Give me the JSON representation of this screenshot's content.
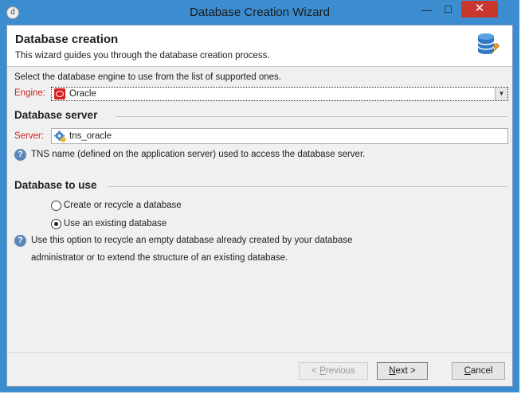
{
  "window": {
    "title": "Database Creation Wizard",
    "app_icon_glyph": "d",
    "controls": {
      "minimize": "—",
      "maximize": "☐",
      "close": "✕"
    }
  },
  "header": {
    "title": "Database creation",
    "subtitle": "This wizard guides you through the database creation process.",
    "icon": "database-wrench-icon"
  },
  "engine": {
    "intro": "Select the database engine to use from the list of supported ones.",
    "label": "Engine:",
    "selected": "Oracle",
    "selected_icon": "oracle-icon"
  },
  "database_server": {
    "heading": "Database server",
    "label": "Server:",
    "value": "tns_oracle",
    "field_icon": "server-gear-icon",
    "help": "TNS name (defined on the application server) used to access the database server."
  },
  "database_to_use": {
    "heading": "Database to use",
    "options": [
      {
        "label": "Create or recycle a database",
        "checked": false
      },
      {
        "label": "Use an existing database",
        "checked": true
      }
    ],
    "help_line1": "Use this option to recycle an empty database already created by your database",
    "help_line2": "administrator or to extend the structure of an existing database."
  },
  "footer": {
    "previous": {
      "prefix": "< ",
      "mnemonic": "P",
      "rest": "revious",
      "enabled": false
    },
    "next": {
      "mnemonic": "N",
      "rest": "ext >",
      "enabled": true
    },
    "cancel": {
      "mnemonic": "C",
      "rest": "ancel",
      "enabled": true
    }
  },
  "colors": {
    "titlebar": "#3c8dd0",
    "close_button": "#c7372e",
    "required_label": "#c8281e",
    "info_icon": "#5b86b8"
  }
}
